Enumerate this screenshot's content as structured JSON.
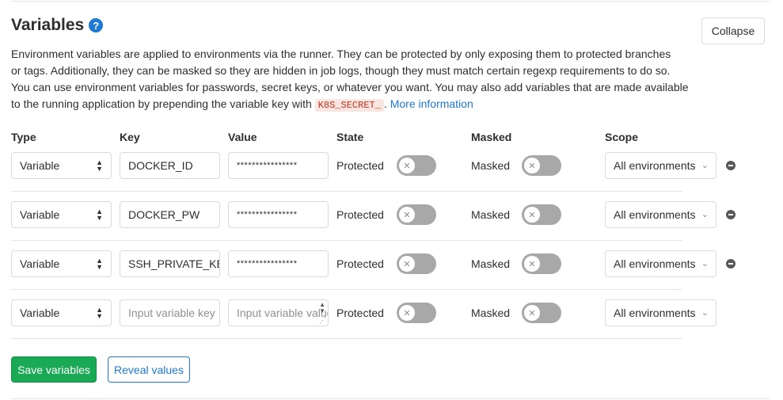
{
  "section": {
    "title": "Variables",
    "collapse_label": "Collapse"
  },
  "description": {
    "line1": "Environment variables are applied to environments via the runner. They can be protected by only exposing them to protected branches",
    "line2": "or tags. Additionally, they can be masked so they are hidden in job logs, though they must match certain regexp requirements to do so.",
    "line3": "You can use environment variables for passwords, secret keys, or whatever you want. You may also add variables that are made available",
    "line4_prefix": "to the running application by prepending the variable key with ",
    "code": "K8S_SECRET_",
    "line4_suffix": ".",
    "link": "More information"
  },
  "columns": {
    "type": "Type",
    "key": "Key",
    "value": "Value",
    "state": "State",
    "masked": "Masked",
    "scope": "Scope"
  },
  "rows": [
    {
      "type": "Variable",
      "key": "DOCKER_ID",
      "value": "****************",
      "state": "Protected",
      "masked": "Masked",
      "scope": "All environments"
    },
    {
      "type": "Variable",
      "key": "DOCKER_PW",
      "value": "****************",
      "state": "Protected",
      "masked": "Masked",
      "scope": "All environments"
    },
    {
      "type": "Variable",
      "key": "SSH_PRIVATE_KEY",
      "value": "****************",
      "state": "Protected",
      "masked": "Masked",
      "scope": "All environments"
    },
    {
      "type": "Variable",
      "key_placeholder": "Input variable key",
      "value_placeholder": "Input variable value",
      "state": "Protected",
      "masked": "Masked",
      "scope": "All environments"
    }
  ],
  "actions": {
    "save": "Save variables",
    "reveal": "Reveal values"
  }
}
